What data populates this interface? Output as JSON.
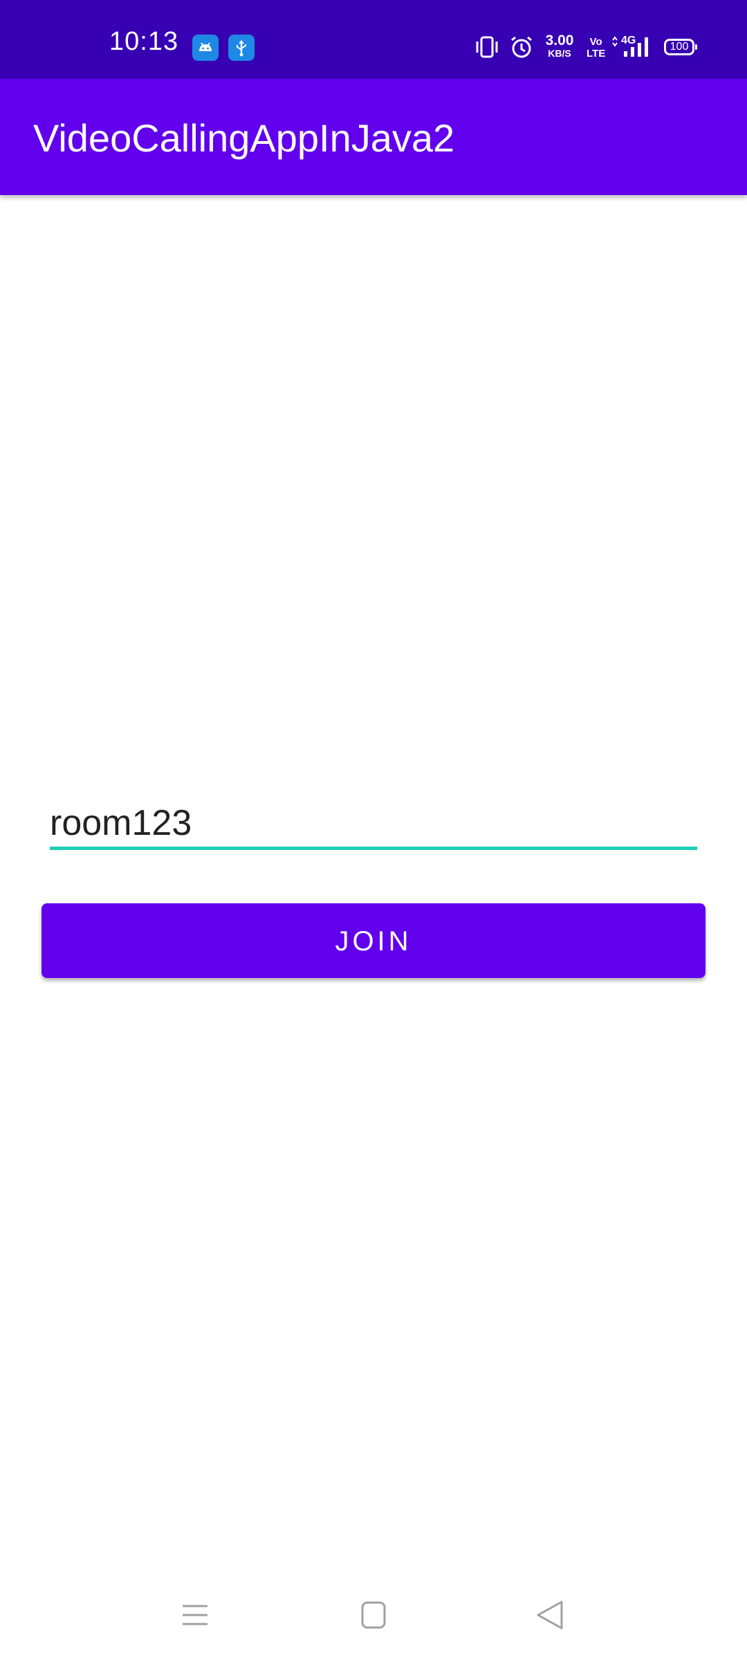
{
  "status_bar": {
    "time": "10:13",
    "notification_icons": [
      "android-icon",
      "usb-icon"
    ],
    "network_speed": "3.00",
    "network_speed_unit": "KB/S",
    "volte_line1": "Vo",
    "volte_line2": "LTE",
    "network_type": "4G",
    "battery_level": "100",
    "background_color": "#3700B3"
  },
  "app_bar": {
    "title": "VideoCallingAppInJava2",
    "background_color": "#6200EE"
  },
  "main": {
    "room_input": {
      "value": "room123",
      "underline_color": "#1ccfb6"
    },
    "join_button": {
      "label": "JOIN",
      "background_color": "#6200EE"
    }
  },
  "nav_bar": {
    "buttons": [
      "menu-icon",
      "home-icon",
      "back-icon"
    ]
  }
}
